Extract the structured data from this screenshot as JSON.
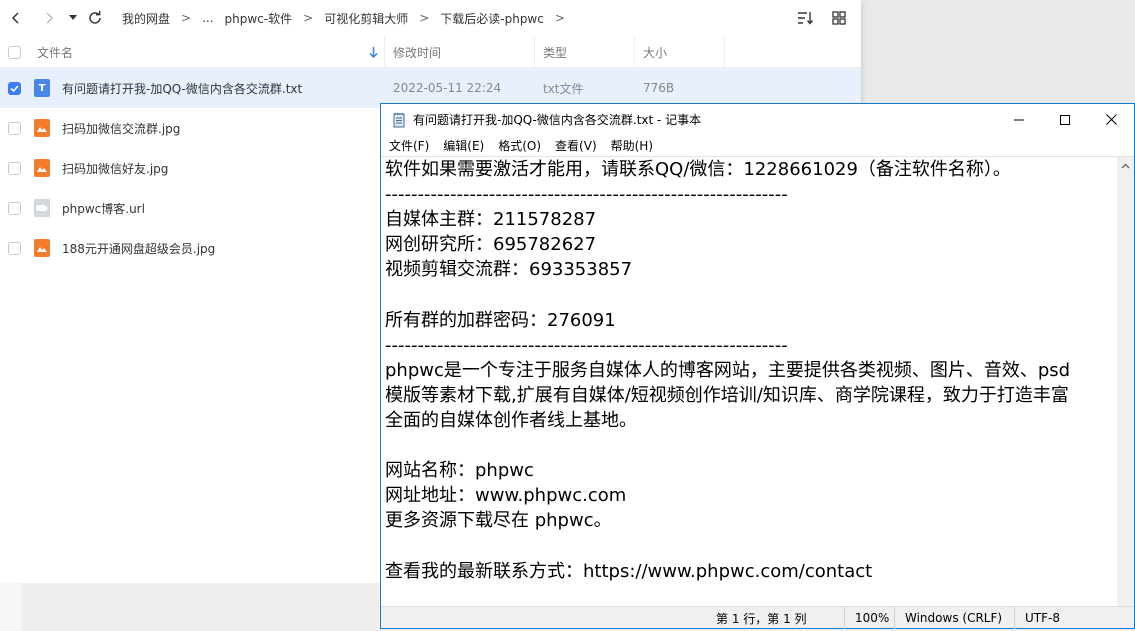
{
  "file_manager": {
    "breadcrumb": [
      "我的网盘",
      "...",
      "phpwc-软件",
      "可视化剪辑大师",
      "下载后必读-phpwc"
    ],
    "columns": {
      "name": "文件名",
      "modified": "修改时间",
      "type": "类型",
      "size": "大小"
    },
    "files": [
      {
        "name": "有问题请打开我-加QQ-微信内含各交流群.txt",
        "modified": "2022-05-11 22:24",
        "type": "txt文件",
        "size": "776B",
        "selected": true,
        "icon": "text-file-icon",
        "color": "#4a86e8"
      },
      {
        "name": "扫码加微信交流群.jpg",
        "icon": "image-file-icon",
        "color": "#f27c2a"
      },
      {
        "name": "扫码加微信好友.jpg",
        "icon": "image-file-icon",
        "color": "#f27c2a"
      },
      {
        "name": "phpwc博客.url",
        "icon": "link-file-icon",
        "color": "#c8ccd2"
      },
      {
        "name": "188元开通网盘超级会员.jpg",
        "icon": "image-file-icon",
        "color": "#f27c2a"
      }
    ]
  },
  "notepad": {
    "title": "有问题请打开我-加QQ-微信内含各交流群.txt - 记事本",
    "menu": [
      "文件(F)",
      "编辑(E)",
      "格式(O)",
      "查看(V)",
      "帮助(H)"
    ],
    "lines": [
      "软件如果需要激活才能用，请联系QQ/微信：1228661029（备注软件名称）。",
      "--------------------------------------------------------------",
      "自媒体主群：211578287",
      "网创研究所：695782627",
      "视频剪辑交流群：693353857",
      "",
      "所有群的加群密码：276091",
      "--------------------------------------------------------------",
      "phpwc是一个专注于服务自媒体人的博客网站，主要提供各类视频、图片、音效、psd",
      "模版等素材下载,扩展有自媒体/短视频创作培训/知识库、商学院课程，致力于打造丰富",
      "全面的自媒体创作者线上基地。",
      "",
      "网站名称：phpwc",
      "网址地址：www.phpwc.com",
      "更多资源下载尽在 phpwc。",
      "",
      "查看我的最新联系方式：https://www.phpwc.com/contact"
    ],
    "status": {
      "position": "第 1 行，第 1 列",
      "zoom": "100%",
      "line_ending": "Windows (CRLF)",
      "encoding": "UTF-8"
    }
  }
}
